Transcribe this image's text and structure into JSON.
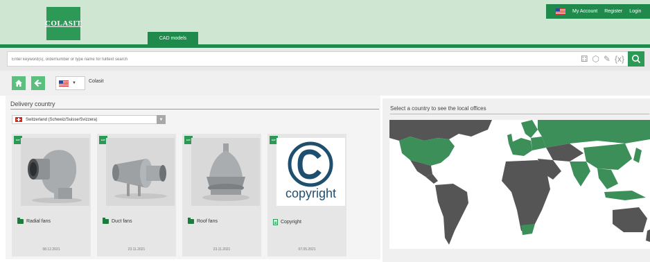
{
  "header": {
    "logo_text": "COLASIT",
    "cad_tab_label": "CAD models",
    "my_account_label": "My Account",
    "register_label": "Register",
    "login_label": "Login",
    "brand_color": "#2c9a56"
  },
  "search": {
    "placeholder": "Enter keyword(s), ordernumber or type name for fulltext search",
    "tool_icons": [
      "hierarchy-icon",
      "cube-icon",
      "pencil-icon",
      "variables-icon"
    ],
    "tool_glyphs": [
      "⚃",
      "⬡",
      "✎",
      "{x}"
    ]
  },
  "toolbar": {
    "breadcrumb": "Colasit",
    "language_icon": "us-flag-icon"
  },
  "delivery": {
    "title": "Delivery country",
    "selected_country": "Switzerland (Schweiz/Suisse/Svizzera)"
  },
  "products": [
    {
      "name": "Radial fans",
      "date": "08.12.2021",
      "badge": "EAT",
      "type": "folder"
    },
    {
      "name": "Duct fans",
      "date": "23.11.2021",
      "badge": "EAT",
      "type": "folder"
    },
    {
      "name": "Roof fans",
      "date": "23.11.2021",
      "badge": "EAT",
      "type": "folder"
    },
    {
      "name": "Copyright",
      "date": "07.05.2021",
      "badge": "EAT",
      "type": "document",
      "thumb_text": "copyright"
    }
  ],
  "map_panel": {
    "title": "Select a country to see the local offices",
    "highlight_color": "#3d8f5a",
    "land_color": "#555555"
  }
}
